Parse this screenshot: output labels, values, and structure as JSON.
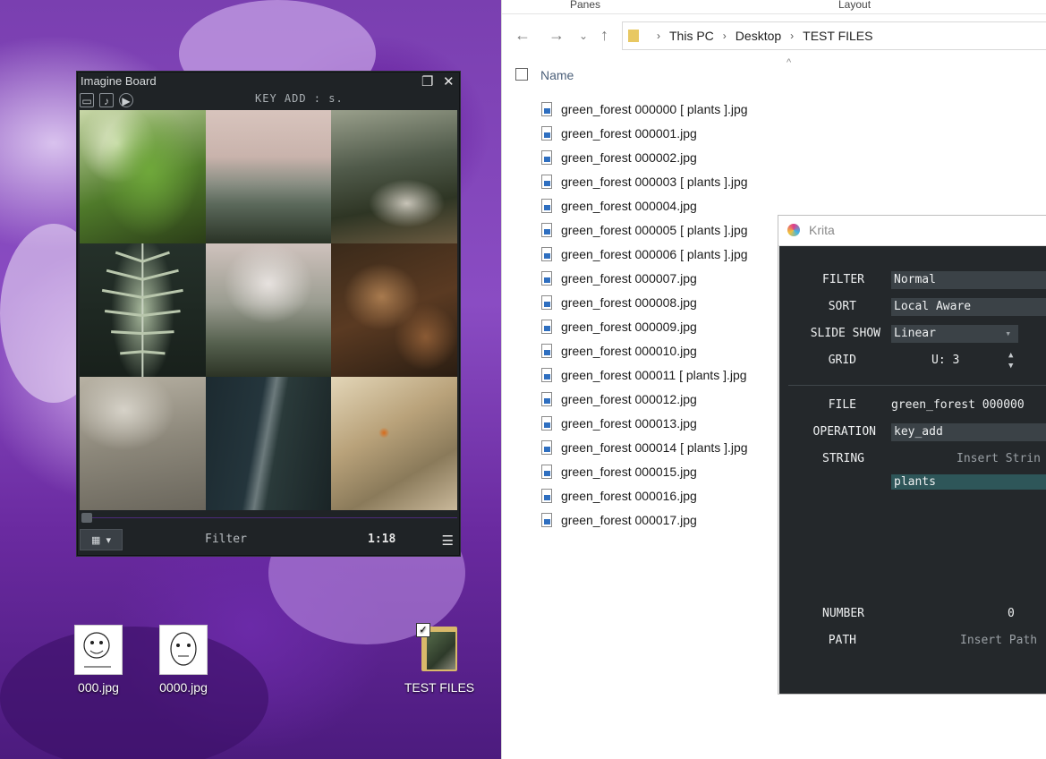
{
  "desktop": {
    "icons": [
      {
        "label": "000.jpg"
      },
      {
        "label": "0000.jpg"
      },
      {
        "label": "TEST FILES"
      }
    ]
  },
  "imagine_board": {
    "title": "Imagine Board",
    "key_add_text": "KEY ADD : s.",
    "filter_label": "Filter",
    "counter": "1:18",
    "toolbar_icons": [
      "folder-icon",
      "file-music-icon",
      "play-icon"
    ],
    "window_icons": [
      "restore-icon",
      "close-icon"
    ]
  },
  "explorer": {
    "ribbon": {
      "panes": "Panes",
      "layout": "Layout"
    },
    "breadcrumb": [
      "This PC",
      "Desktop",
      "TEST FILES"
    ],
    "column_name": "Name",
    "files": [
      "green_forest 000000 [ plants ].jpg",
      "green_forest 000001.jpg",
      "green_forest 000002.jpg",
      "green_forest 000003 [ plants ].jpg",
      "green_forest 000004.jpg",
      "green_forest 000005 [ plants ].jpg",
      "green_forest 000006 [ plants ].jpg",
      "green_forest 000007.jpg",
      "green_forest 000008.jpg",
      "green_forest 000009.jpg",
      "green_forest 000010.jpg",
      "green_forest 000011 [ plants ].jpg",
      "green_forest 000012.jpg",
      "green_forest 000013.jpg",
      "green_forest 000014 [ plants ].jpg",
      "green_forest 000015.jpg",
      "green_forest 000016.jpg",
      "green_forest 000017.jpg"
    ]
  },
  "krita": {
    "title": "Krita",
    "filter_label": "FILTER",
    "filter_value": "Normal",
    "sort_label": "SORT",
    "sort_value": "Local Aware",
    "slideshow_label": "SLIDE SHOW",
    "slideshow_value": "Linear",
    "grid_label": "GRID",
    "grid_value": "U: 3",
    "file_label": "FILE",
    "file_value": "green_forest 000000",
    "operation_label": "OPERATION",
    "operation_value": "key_add",
    "string_label": "STRING",
    "string_placeholder": "Insert Strin",
    "string_value": "plants",
    "number_label": "NUMBER",
    "number_value": "0",
    "path_label": "PATH",
    "path_placeholder": "Insert Path"
  }
}
